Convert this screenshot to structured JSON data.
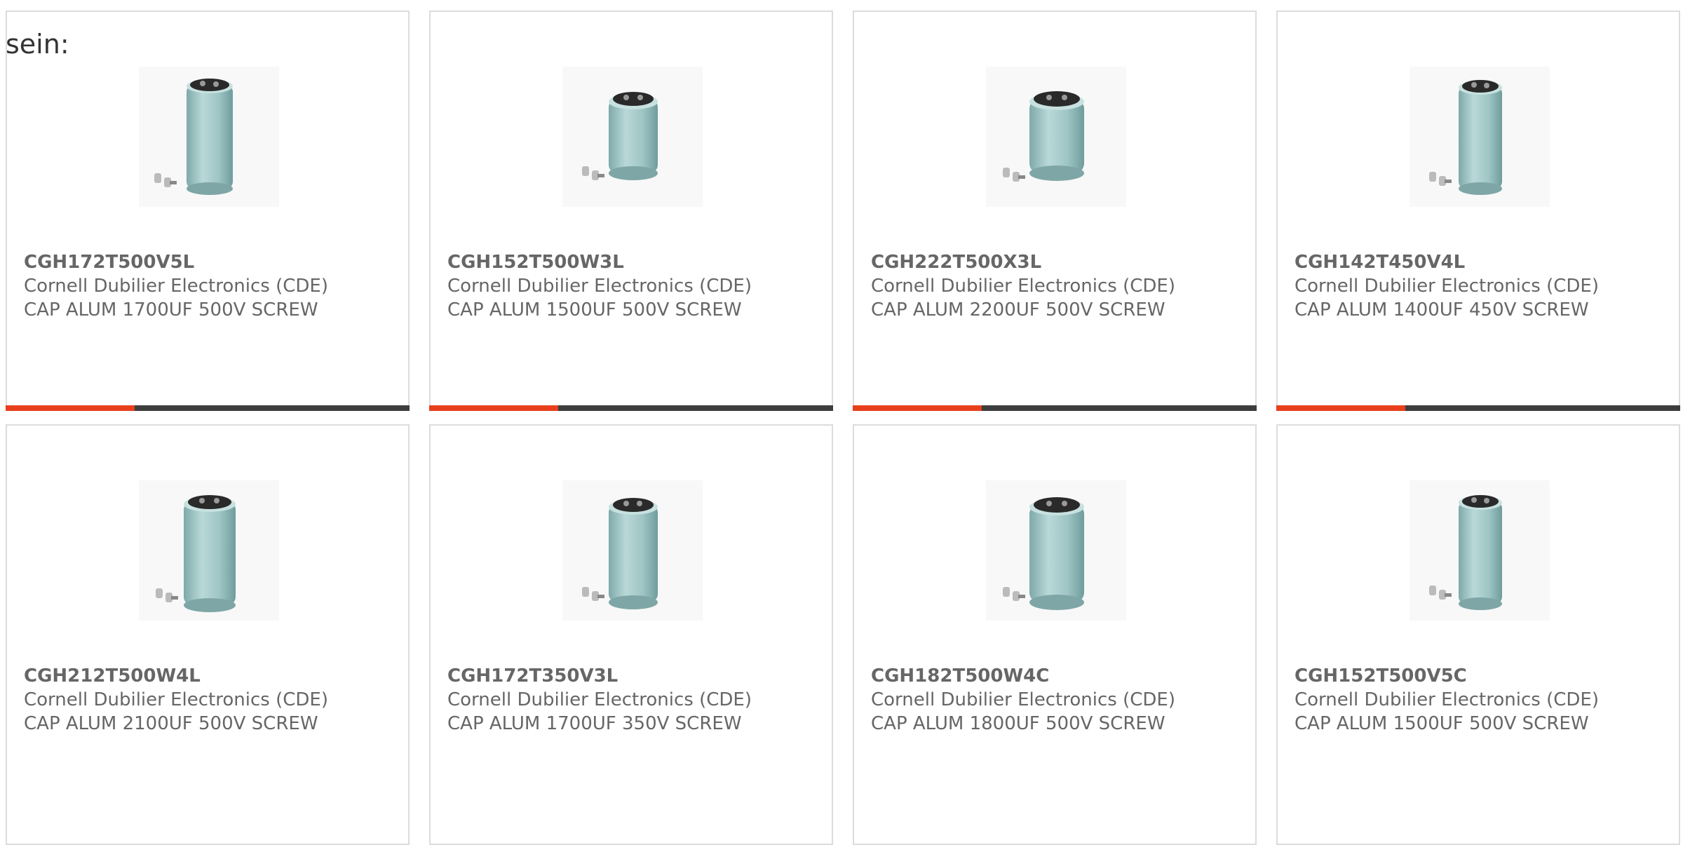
{
  "intro_text": "sein:",
  "colors": {
    "accent": "#e8401c",
    "bar": "#3d3d3d",
    "border": "#dcdcdc",
    "text": "#666666"
  },
  "products": [
    {
      "part_number": "CGH172T500V5L",
      "manufacturer": "Cornell Dubilier Electronics (CDE)",
      "description": "CAP ALUM 1700UF 500V SCREW",
      "image_icon": "capacitor-tall-icon"
    },
    {
      "part_number": "CGH152T500W3L",
      "manufacturer": "Cornell Dubilier Electronics (CDE)",
      "description": "CAP ALUM 1500UF 500V SCREW",
      "image_icon": "capacitor-short-icon"
    },
    {
      "part_number": "CGH222T500X3L",
      "manufacturer": "Cornell Dubilier Electronics (CDE)",
      "description": "CAP ALUM 2200UF 500V SCREW",
      "image_icon": "capacitor-short-icon"
    },
    {
      "part_number": "CGH142T450V4L",
      "manufacturer": "Cornell Dubilier Electronics (CDE)",
      "description": "CAP ALUM 1400UF 450V SCREW",
      "image_icon": "capacitor-tall-icon"
    },
    {
      "part_number": "CGH212T500W4L",
      "manufacturer": "Cornell Dubilier Electronics (CDE)",
      "description": "CAP ALUM 2100UF 500V SCREW",
      "image_icon": "capacitor-tall-icon"
    },
    {
      "part_number": "CGH172T350V3L",
      "manufacturer": "Cornell Dubilier Electronics (CDE)",
      "description": "CAP ALUM 1700UF 350V SCREW",
      "image_icon": "capacitor-tall-icon"
    },
    {
      "part_number": "CGH182T500W4C",
      "manufacturer": "Cornell Dubilier Electronics (CDE)",
      "description": "CAP ALUM 1800UF 500V SCREW",
      "image_icon": "capacitor-tall-icon"
    },
    {
      "part_number": "CGH152T500V5C",
      "manufacturer": "Cornell Dubilier Electronics (CDE)",
      "description": "CAP ALUM 1500UF 500V SCREW",
      "image_icon": "capacitor-tall-icon"
    }
  ]
}
